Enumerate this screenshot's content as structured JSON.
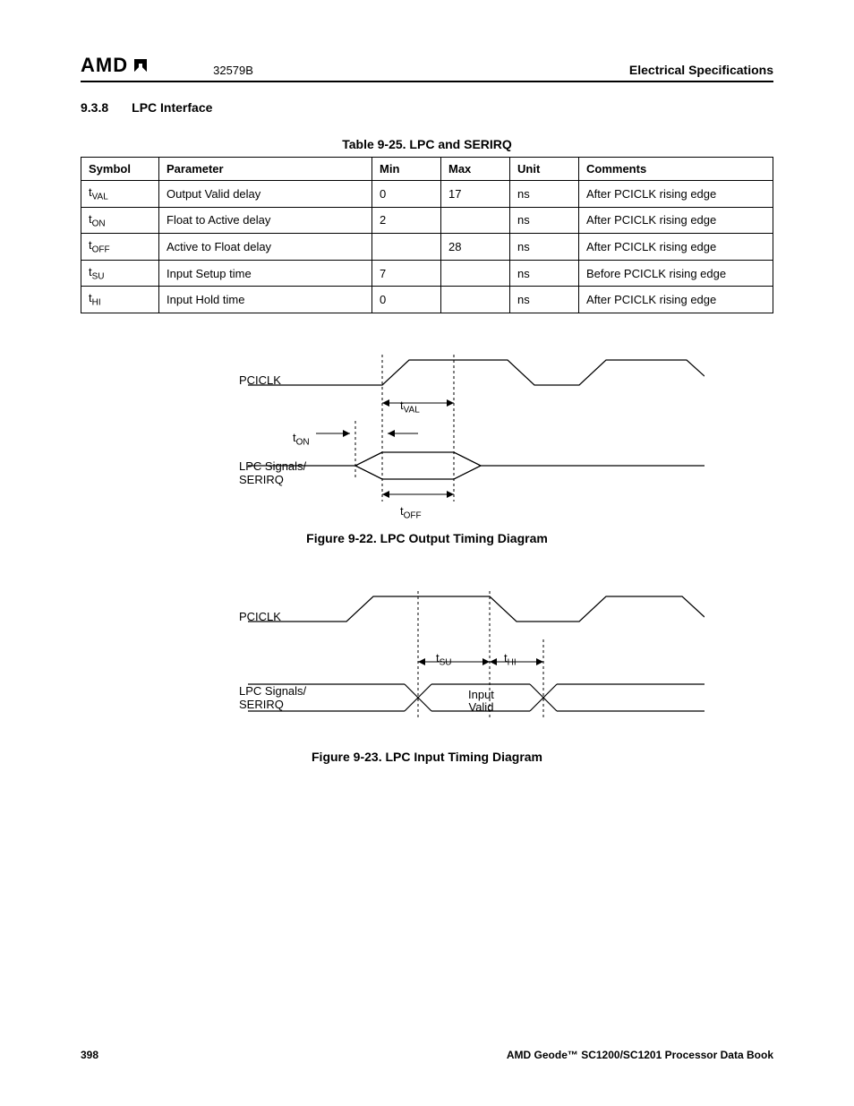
{
  "header": {
    "logo_text": "AMD",
    "doc_id": "32579B",
    "section_title": "Electrical Specifications"
  },
  "section": {
    "number": "9.3.8",
    "title": "LPC Interface"
  },
  "table": {
    "caption": "Table 9-25.  LPC and SERIRQ",
    "columns": {
      "symbol": "Symbol",
      "parameter": "Parameter",
      "min": "Min",
      "max": "Max",
      "unit": "Unit",
      "comments": "Comments"
    },
    "rows": [
      {
        "symbol_base": "t",
        "symbol_sub": "VAL",
        "parameter": "Output Valid delay",
        "min": "0",
        "max": "17",
        "unit": "ns",
        "comments": "After PCICLK rising edge"
      },
      {
        "symbol_base": "t",
        "symbol_sub": "ON",
        "parameter": "Float to Active delay",
        "min": "2",
        "max": "",
        "unit": "ns",
        "comments": "After PCICLK rising edge"
      },
      {
        "symbol_base": "t",
        "symbol_sub": "OFF",
        "parameter": "Active to Float delay",
        "min": "",
        "max": "28",
        "unit": "ns",
        "comments": "After PCICLK rising edge"
      },
      {
        "symbol_base": "t",
        "symbol_sub": "SU",
        "parameter": "Input Setup time",
        "min": "7",
        "max": "",
        "unit": "ns",
        "comments": "Before PCICLK rising edge"
      },
      {
        "symbol_base": "t",
        "symbol_sub": "HI",
        "parameter": "Input Hold time",
        "min": "0",
        "max": "",
        "unit": "ns",
        "comments": "After PCICLK rising edge"
      }
    ]
  },
  "figure1": {
    "caption": "Figure 9-22.  LPC Output Timing Diagram",
    "labels": {
      "pciclk": "PCICLK",
      "signals_line1": "LPC Signals/",
      "signals_line2": "SERIRQ",
      "tval_base": "t",
      "tval_sub": "VAL",
      "ton_base": "t",
      "ton_sub": "ON",
      "toff_base": "t",
      "toff_sub": "OFF"
    }
  },
  "figure2": {
    "caption": "Figure 9-23.  LPC Input Timing Diagram",
    "labels": {
      "pciclk": "PCICLK",
      "signals_line1": "LPC Signals/",
      "signals_line2": "SERIRQ",
      "tsu_base": "t",
      "tsu_sub": "SU",
      "thi_base": "t",
      "thi_sub": "HI",
      "input_line1": "Input",
      "input_line2": "Valid"
    }
  },
  "footer": {
    "page": "398",
    "book": "AMD Geode™ SC1200/SC1201 Processor Data Book"
  }
}
